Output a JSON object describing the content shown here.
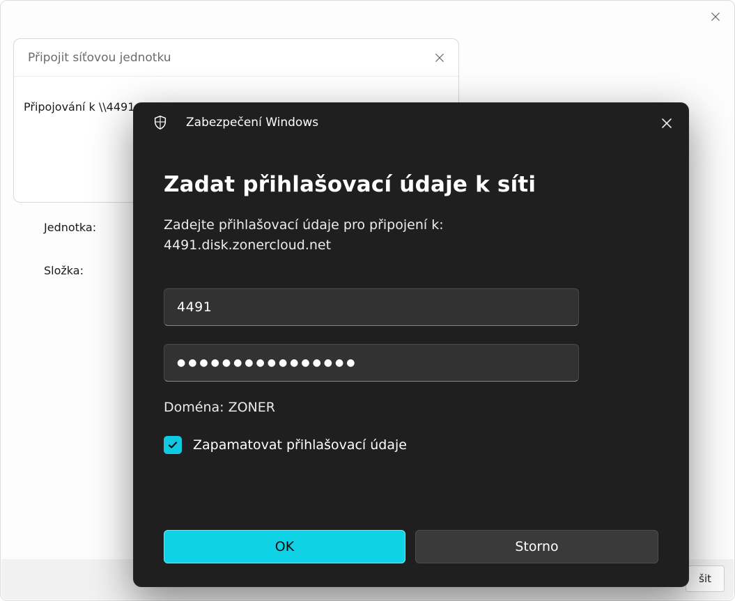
{
  "outer": {
    "bottom_button_fragment": "šit"
  },
  "map_dialog": {
    "title": "Připojit síťovou jednotku",
    "connecting_line": "Připojování k \\\\4491",
    "unit_label": "Jednotka:",
    "folder_label": "Složka:"
  },
  "security_dialog": {
    "app_title": "Zabezpečení Windows",
    "heading": "Zadat přihlašovací údaje k síti",
    "subtitle_line1": "Zadejte přihlašovací údaje pro připojení k:",
    "subtitle_line2": "4491.disk.zonercloud.net",
    "username_value": "4491",
    "password_value": "●●●●●●●●●●●●●●●●",
    "domain_label": "Doména: ZONER",
    "remember_label": "Zapamatovat přihlašovací údaje",
    "ok_label": "OK",
    "cancel_label": "Storno",
    "remember_checked": true,
    "accent_color": "#0fd2e6"
  }
}
